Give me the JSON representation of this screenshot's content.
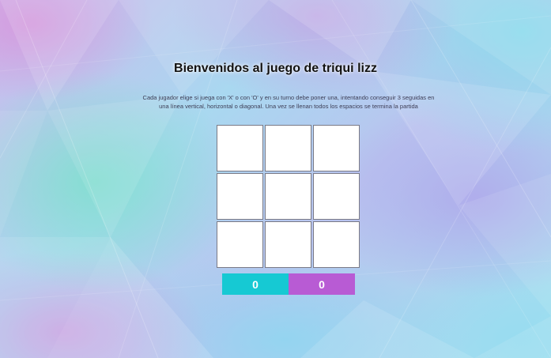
{
  "game": {
    "title": "Bienvenidos al juego de triqui lizz",
    "instructions": "Cada jugador elige si juega con 'X' o con 'O' y en su turno debe poner una, intentando conseguir 3 seguidas en una línea vertical, horizontal o diagonal. Una vez se llenan todos los espacios se termina la partida",
    "board": {
      "cells": [
        "",
        "",
        "",
        "",
        "",
        "",
        "",
        "",
        ""
      ]
    },
    "scores": {
      "player_x": {
        "value": "0",
        "color": "#16c9d3"
      },
      "player_o": {
        "value": "0",
        "color": "#b85bd4"
      }
    }
  }
}
